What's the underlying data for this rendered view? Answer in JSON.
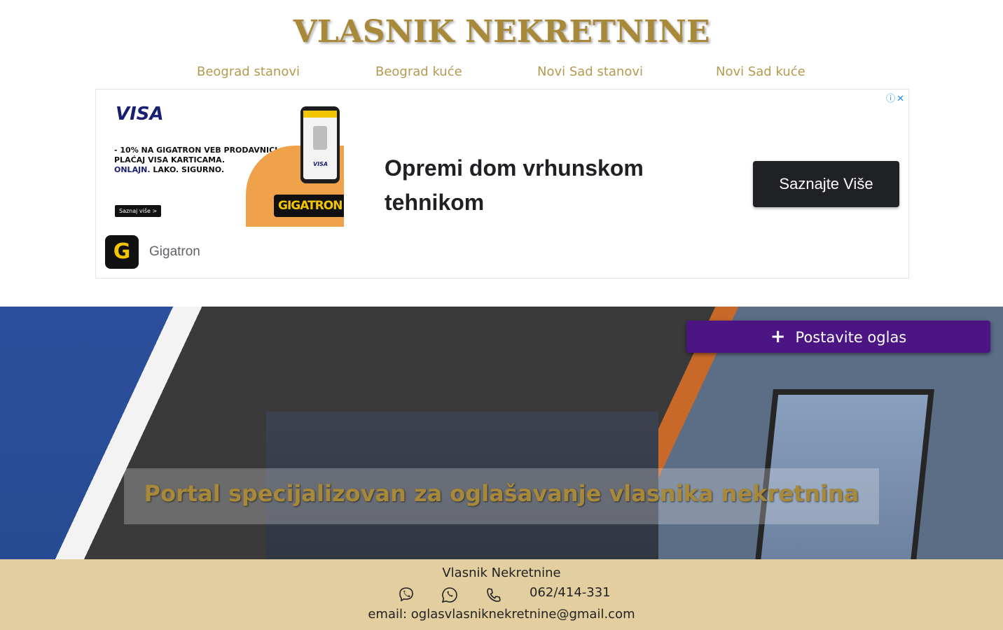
{
  "site": {
    "title": "VLASNIK NEKRETNINE"
  },
  "nav": {
    "items": [
      {
        "label": "Beograd stanovi"
      },
      {
        "label": "Beograd kuće"
      },
      {
        "label": "Novi Sad stanovi"
      },
      {
        "label": "Novi Sad kuće"
      }
    ]
  },
  "ad": {
    "choices_icon": "adchoices-icon",
    "close_icon": "close-icon",
    "visa_logo": "VISA",
    "promo_line1": "- 10% NA GIGATRON VEB PRODAVNICI.",
    "promo_line2": "PLAĆAJ VISA KARTICAMA.",
    "promo_line3_blue": "ONLAJN.",
    "promo_line3_rest": " LAKO. SIGURNO.",
    "small_button": "Saznaj više >",
    "phone_visa": "VISA",
    "badge": "GIGATRON",
    "headline": "Opremi dom vrhunskom tehnikom",
    "cta": "Saznajte Više",
    "brand_logo_letter": "G",
    "brand_name": "Gigatron",
    "colors": {
      "cta_bg": "#202124",
      "badge_yellow": "#f3c400"
    }
  },
  "hero": {
    "post_button": "Postavite oglas",
    "post_button_icon": "plus-icon",
    "tagline": "Portal specijalizovan za oglašavanje vlasnika nekretnina",
    "colors": {
      "button_bg": "#4b1684",
      "tagline": "#a8893a"
    }
  },
  "footer": {
    "title": "Vlasnik Nekretnine",
    "icons": [
      "viber-icon",
      "whatsapp-icon",
      "phone-icon"
    ],
    "phone": "062/414-331",
    "email": "email: oglasvlasniknekretnine@gmail.com",
    "colors": {
      "background": "#e3cea0"
    }
  }
}
